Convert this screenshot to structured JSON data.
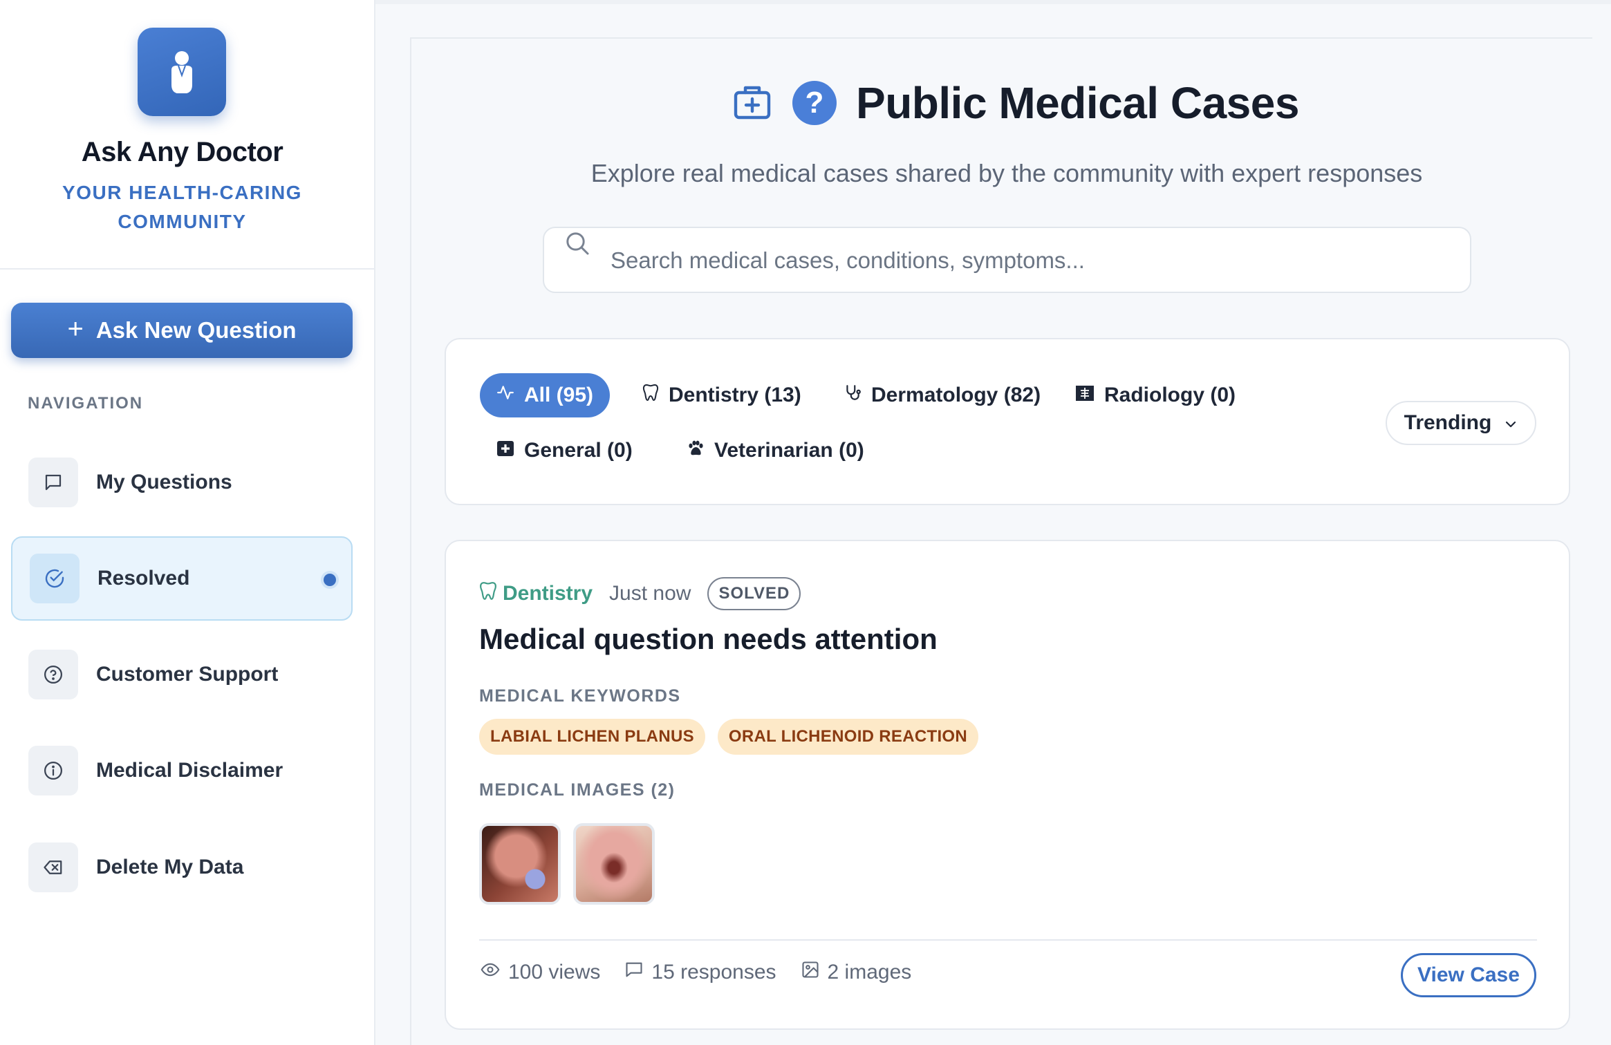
{
  "brand": {
    "name": "Ask Any Doctor",
    "tagline": "YOUR HEALTH-CARING COMMUNITY"
  },
  "sidebar": {
    "ask_button": "Ask New Question",
    "nav_title": "NAVIGATION",
    "items": [
      {
        "label": "My Questions",
        "icon": "message-square-icon"
      },
      {
        "label": "Resolved",
        "icon": "check-circle-icon",
        "active": true
      },
      {
        "label": "Customer Support",
        "icon": "help-circle-icon"
      },
      {
        "label": "Medical Disclaimer",
        "icon": "info-icon"
      },
      {
        "label": "Delete My Data",
        "icon": "delete-backspace-icon"
      }
    ]
  },
  "header": {
    "title": "Public Medical Cases",
    "subtitle": "Explore real medical cases shared by the community with expert responses"
  },
  "search": {
    "placeholder": "Search medical cases, conditions, symptoms...",
    "value": ""
  },
  "filters": {
    "categories": [
      {
        "label": "All (95)",
        "icon": "activity-icon",
        "active": true
      },
      {
        "label": "Dentistry (13)",
        "icon": "tooth-icon"
      },
      {
        "label": "Dermatology (82)",
        "icon": "stethoscope-icon"
      },
      {
        "label": "Radiology (0)",
        "icon": "x-ray-icon"
      },
      {
        "label": "General (0)",
        "icon": "medical-plus-icon"
      },
      {
        "label": "Veterinarian (0)",
        "icon": "paw-icon"
      }
    ],
    "sort": "Trending"
  },
  "case": {
    "category": "Dentistry",
    "time": "Just now",
    "status": "SOLVED",
    "title": "Medical question needs attention",
    "keywords_label": "MEDICAL KEYWORDS",
    "keywords": [
      "LABIAL LICHEN PLANUS",
      "ORAL LICHENOID REACTION"
    ],
    "images_label": "MEDICAL IMAGES (2)",
    "views": "100 views",
    "responses": "15 responses",
    "images": "2 images",
    "view_button": "View Case"
  },
  "colors": {
    "accent": "#3a6fc2",
    "dentistry": "#3f9c86",
    "keyword_bg": "#fde9c8",
    "keyword_text": "#8a3b12"
  }
}
